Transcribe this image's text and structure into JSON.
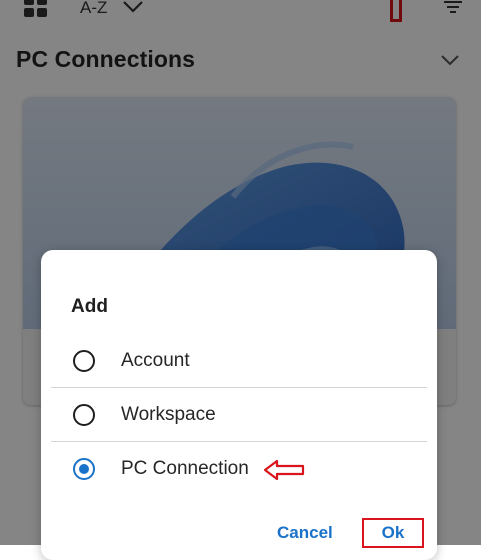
{
  "toolbar": {
    "sort_label": "A-Z",
    "icons": [
      "grid-view-icon",
      "chevron-down-icon",
      "filter-icon"
    ]
  },
  "section": {
    "title": "PC Connections"
  },
  "dialog": {
    "title": "Add",
    "options": [
      {
        "label": "Account",
        "selected": false
      },
      {
        "label": "Workspace",
        "selected": false
      },
      {
        "label": "PC Connection",
        "selected": true
      }
    ],
    "cancel_label": "Cancel",
    "ok_label": "Ok"
  },
  "colors": {
    "accent": "#1a73c8",
    "annotation_red": "#d9141c",
    "scrim": "rgba(0,0,0,0.48)"
  }
}
